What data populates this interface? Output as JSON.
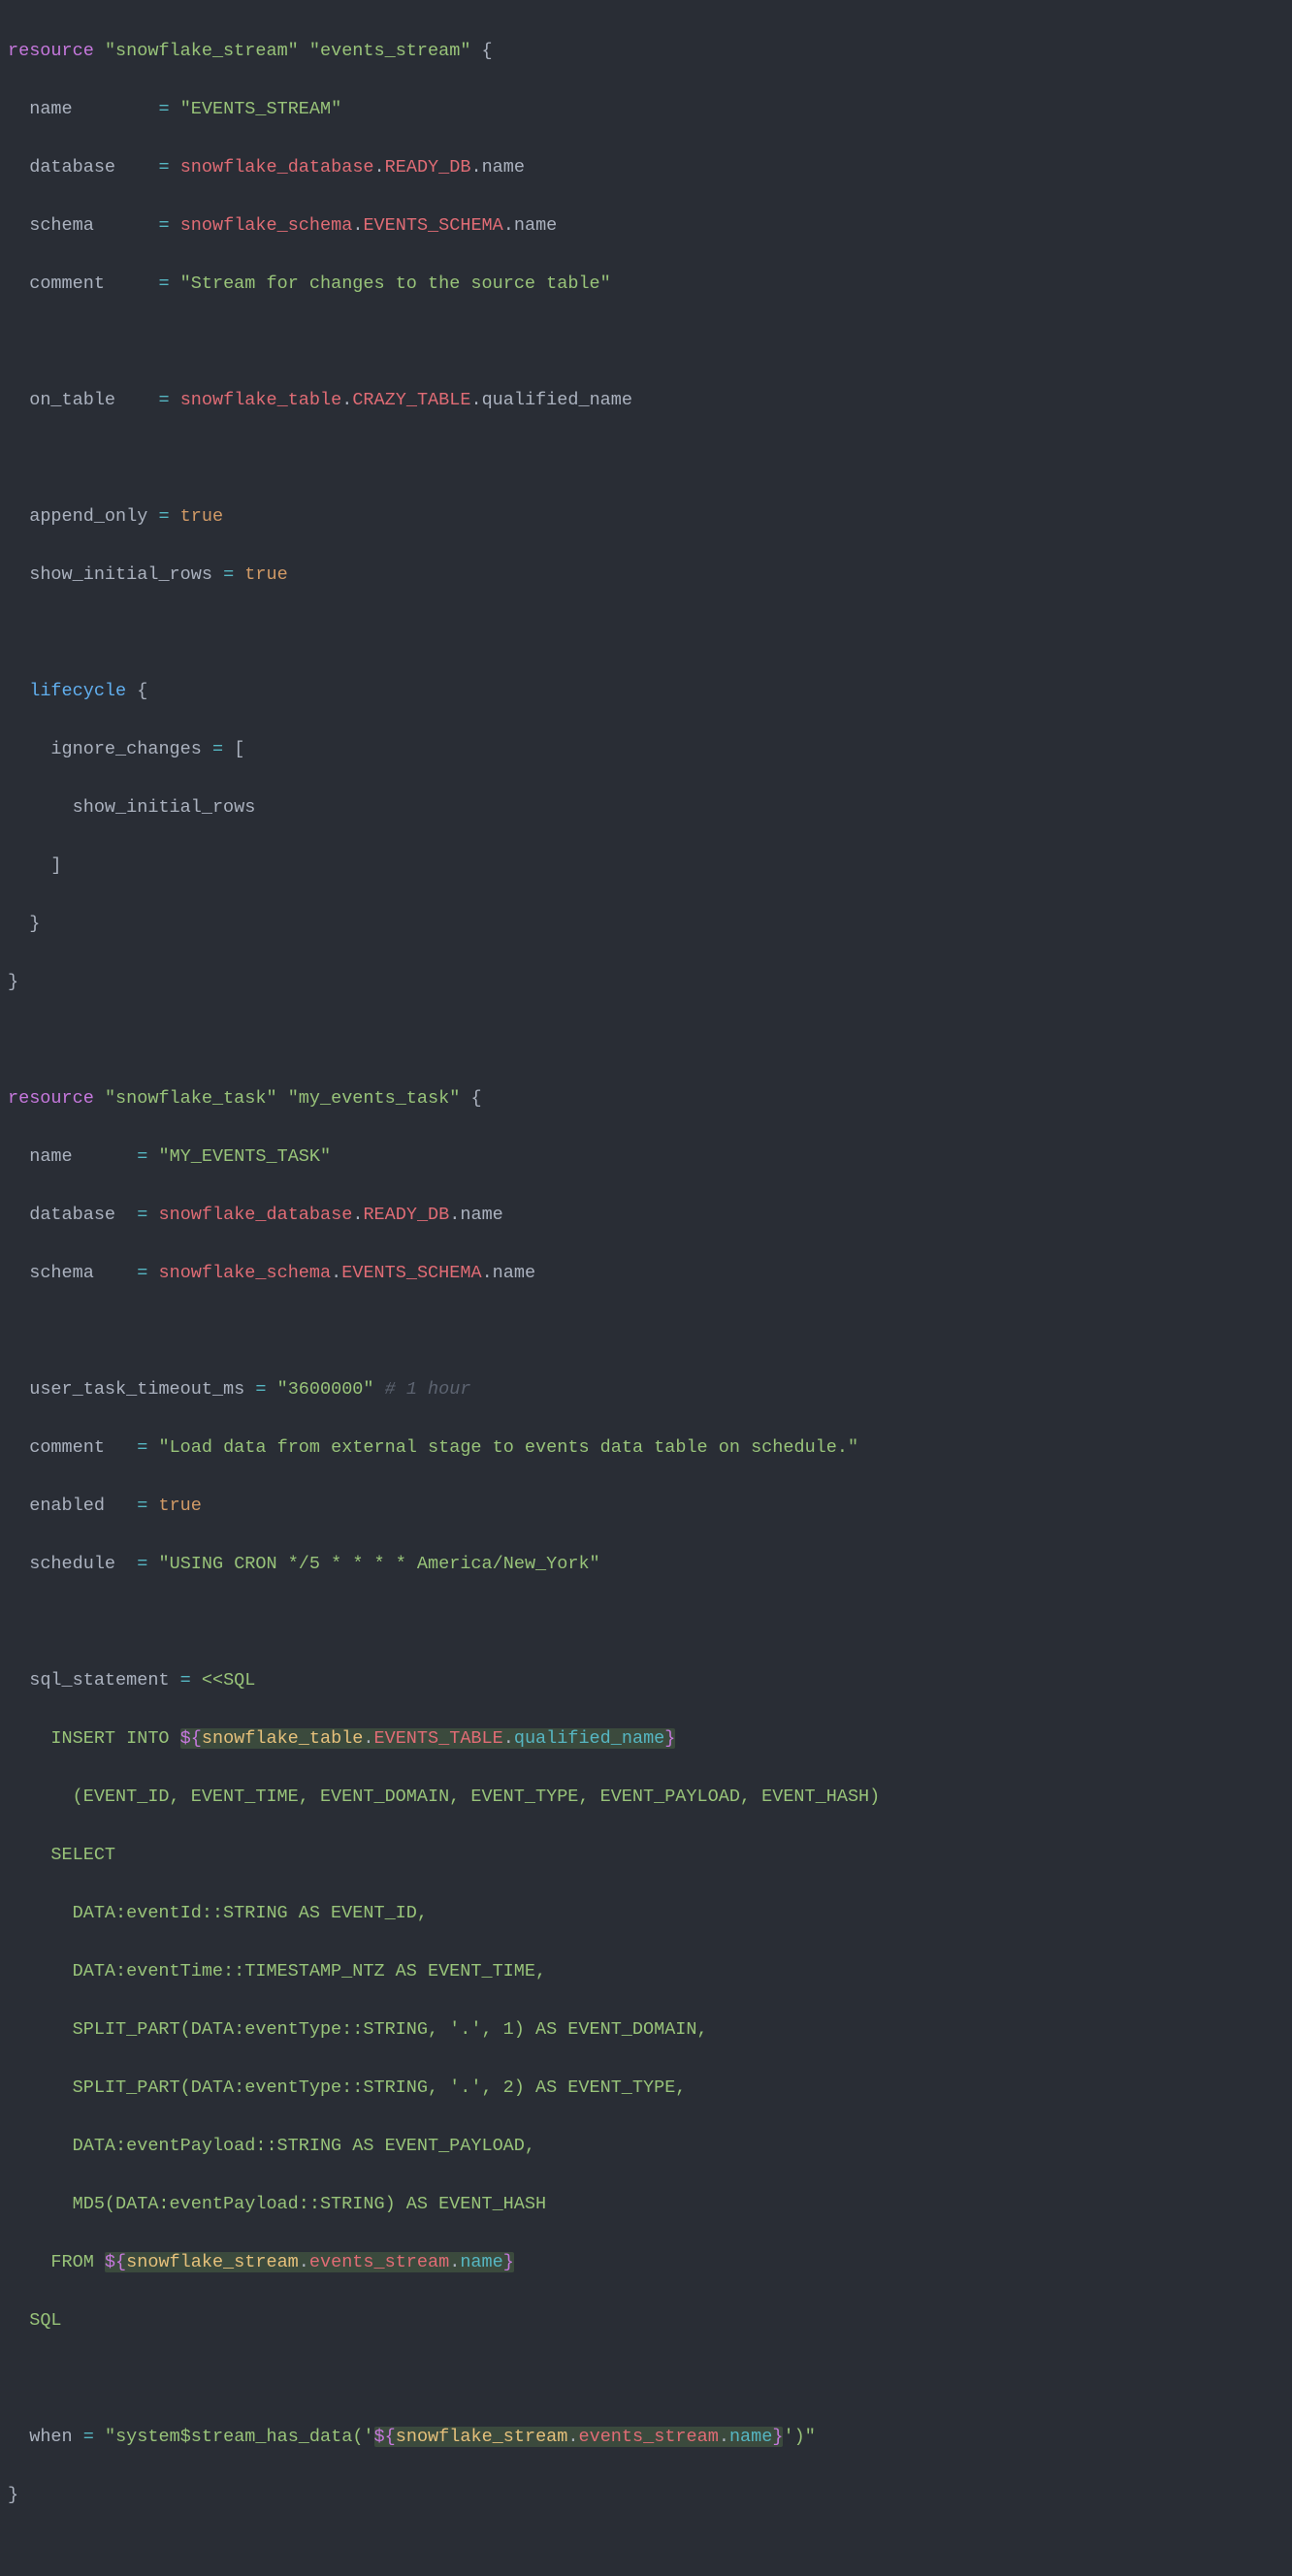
{
  "code": {
    "r1": {
      "keyword": "resource",
      "type_str": "\"snowflake_stream\"",
      "name_str": "\"events_stream\"",
      "open": "{",
      "name": {
        "k": "name",
        "eq": "=",
        "v": "\"EVENTS_STREAM\""
      },
      "database": {
        "k": "database",
        "eq": "=",
        "ref1": "snowflake_database",
        "dot1": ".",
        "ref2": "READY_DB",
        "dot2": ".",
        "ref3": "name"
      },
      "schema": {
        "k": "schema",
        "eq": "=",
        "ref1": "snowflake_schema",
        "dot1": ".",
        "ref2": "EVENTS_SCHEMA",
        "dot2": ".",
        "ref3": "name"
      },
      "comment": {
        "k": "comment",
        "eq": "=",
        "v": "\"Stream for changes to the source table\""
      },
      "on_table": {
        "k": "on_table",
        "eq": "=",
        "ref1": "snowflake_table",
        "dot1": ".",
        "ref2": "CRAZY_TABLE",
        "dot2": ".",
        "ref3": "qualified_name"
      },
      "append_only": {
        "k": "append_only",
        "eq": "=",
        "v": "true"
      },
      "show_initial_rows": {
        "k": "show_initial_rows",
        "eq": "=",
        "v": "true"
      },
      "lifecycle": {
        "k": "lifecycle",
        "open": "{",
        "ignore_changes": {
          "k": "ignore_changes",
          "eq": "=",
          "open": "[",
          "item": "show_initial_rows",
          "close": "]"
        },
        "close": "}"
      },
      "close": "}"
    },
    "r2": {
      "keyword": "resource",
      "type_str": "\"snowflake_task\"",
      "name_str": "\"my_events_task\"",
      "open": "{",
      "name": {
        "k": "name",
        "eq": "=",
        "v": "\"MY_EVENTS_TASK\""
      },
      "database": {
        "k": "database",
        "eq": "=",
        "ref1": "snowflake_database",
        "dot1": ".",
        "ref2": "READY_DB",
        "dot2": ".",
        "ref3": "name"
      },
      "schema": {
        "k": "schema",
        "eq": "=",
        "ref1": "snowflake_schema",
        "dot1": ".",
        "ref2": "EVENTS_SCHEMA",
        "dot2": ".",
        "ref3": "name"
      },
      "timeout": {
        "k": "user_task_timeout_ms",
        "eq": "=",
        "v": "\"3600000\"",
        "cmt": "# 1 hour"
      },
      "comment": {
        "k": "comment",
        "eq": "=",
        "v": "\"Load data from external stage to events data table on schedule.\""
      },
      "enabled": {
        "k": "enabled",
        "eq": "=",
        "v": "true"
      },
      "schedule": {
        "k": "schedule",
        "eq": "=",
        "v": "\"USING CRON */5 * * * * America/New_York\""
      },
      "sql": {
        "k": "sql_statement",
        "eq": "=",
        "heredoc_open": "<<SQL",
        "l1a": "    INSERT INTO ",
        "l1_interp": {
          "d1": "${",
          "n1": "snowflake_table",
          "dot1": ".",
          "n2": "EVENTS_TABLE",
          "dot2": ".",
          "n3": "qualified_name",
          "d2": "}"
        },
        "l2": "      (EVENT_ID, EVENT_TIME, EVENT_DOMAIN, EVENT_TYPE, EVENT_PAYLOAD, EVENT_HASH)",
        "l3": "    SELECT",
        "l4": "      DATA:eventId::STRING AS EVENT_ID,",
        "l5": "      DATA:eventTime::TIMESTAMP_NTZ AS EVENT_TIME,",
        "l6": "      SPLIT_PART(DATA:eventType::STRING, '.', 1) AS EVENT_DOMAIN,",
        "l7": "      SPLIT_PART(DATA:eventType::STRING, '.', 2) AS EVENT_TYPE,",
        "l8": "      DATA:eventPayload::STRING AS EVENT_PAYLOAD,",
        "l9": "      MD5(DATA:eventPayload::STRING) AS EVENT_HASH",
        "l10a": "    FROM ",
        "l10_interp": {
          "d1": "${",
          "n1": "snowflake_stream",
          "dot1": ".",
          "n2": "events_stream",
          "dot2": ".",
          "n3": "name",
          "d2": "}"
        },
        "heredoc_close": "SQL"
      },
      "when": {
        "k": "when",
        "eq": "=",
        "q1": "\"",
        "pre": "system$stream_has_data('",
        "interp": {
          "d1": "${",
          "n1": "snowflake_stream",
          "dot1": ".",
          "n2": "events_stream",
          "dot2": ".",
          "n3": "name",
          "d2": "}"
        },
        "post": "')",
        "q2": "\""
      },
      "close": "}"
    }
  }
}
